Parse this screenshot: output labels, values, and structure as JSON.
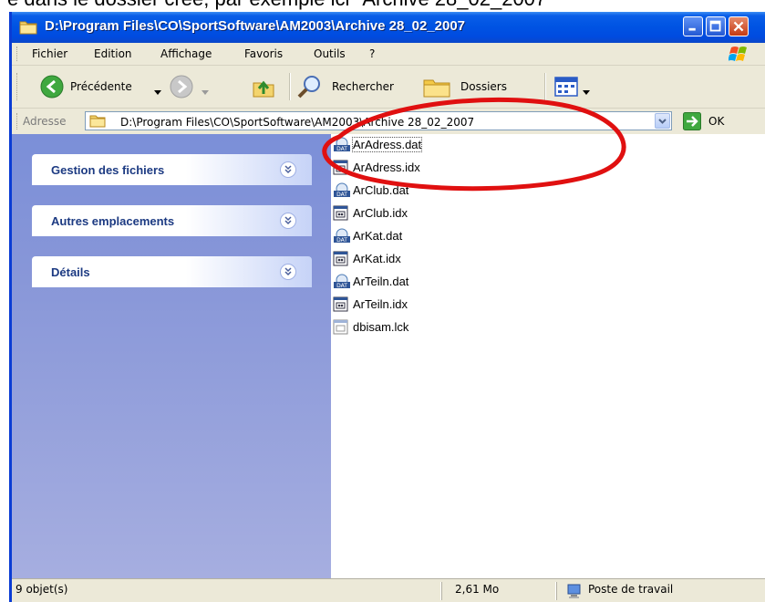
{
  "caption": {
    "text": "e dans le dossier créé, par exemple ici \"Archive 28_02_2007\""
  },
  "window": {
    "title": "D:\\Program Files\\CO\\SportSoftware\\AM2003\\Archive 28_02_2007",
    "titlebar_color": "#0054e3",
    "close_color": "#c43a14"
  },
  "menu": {
    "items": [
      "Fichier",
      "Edition",
      "Affichage",
      "Favoris",
      "Outils",
      "?"
    ]
  },
  "toolbar": {
    "back_label": "Précédente",
    "search_label": "Rechercher",
    "folders_label": "Dossiers"
  },
  "address": {
    "label": "Adresse",
    "value": "D:\\Program Files\\CO\\SportSoftware\\AM2003\\Archive 28_02_2007",
    "go_label": "OK"
  },
  "taskpane": {
    "groups": [
      {
        "title": "Gestion des fichiers",
        "icon": "chevron-down-icon"
      },
      {
        "title": "Autres emplacements",
        "icon": "chevron-down-icon"
      },
      {
        "title": "Détails",
        "icon": "chevron-down-icon"
      }
    ]
  },
  "files": [
    {
      "name": "ArAdress.dat",
      "icon": "dat-file-icon",
      "selected": true
    },
    {
      "name": "ArAdress.idx",
      "icon": "idx-file-icon"
    },
    {
      "name": "ArClub.dat",
      "icon": "dat-file-icon"
    },
    {
      "name": "ArClub.idx",
      "icon": "idx-file-icon"
    },
    {
      "name": "ArKat.dat",
      "icon": "dat-file-icon"
    },
    {
      "name": "ArKat.idx",
      "icon": "idx-file-icon"
    },
    {
      "name": "ArTeiln.dat",
      "icon": "dat-file-icon"
    },
    {
      "name": "ArTeiln.idx",
      "icon": "idx-file-icon"
    },
    {
      "name": "dbisam.lck",
      "icon": "lck-file-icon"
    }
  ],
  "status": {
    "count": "9 objet(s)",
    "size": "2,61 Mo",
    "zone": "Poste de travail"
  },
  "annotation": {
    "color": "#e01010"
  }
}
